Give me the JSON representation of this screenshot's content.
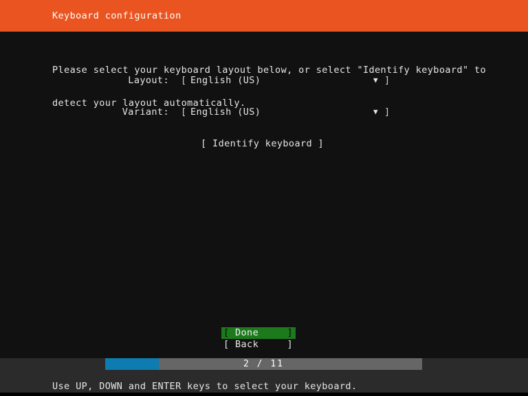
{
  "header": {
    "title": "Keyboard configuration",
    "background_color": "#e95420",
    "text_color": "#ffffff"
  },
  "body": {
    "background_color": "#111111",
    "text_color": "#e6e6e6",
    "prompt_line_1": "Please select your keyboard layout below, or select \"Identify keyboard\" to",
    "prompt_line_2": "detect your layout automatically."
  },
  "form": {
    "bracket_open": "[",
    "bracket_close": "]",
    "dropdown_icon": "▼",
    "rows": [
      {
        "label": "Layout:",
        "value": "English (US)",
        "icon_name": "chevron-down-icon"
      },
      {
        "label": "Variant:",
        "value": "English (US)",
        "icon_name": "chevron-down-icon"
      }
    ]
  },
  "actions": {
    "identify_button": "[ Identify keyboard ]",
    "done": {
      "bracket_open": "[",
      "label": "Done",
      "bracket_close": "]",
      "selected": "true",
      "highlight_color": "#1c7a1c"
    },
    "back": {
      "bracket_open": "[",
      "label": "Back",
      "bracket_close": "]",
      "selected": "false"
    }
  },
  "progress": {
    "text": "2 / 11",
    "current_step": 2,
    "total_steps": 11,
    "fill_color": "#0e7cb0",
    "track_color": "#666666",
    "fill_percent": 17
  },
  "footer": {
    "background_color": "#2b2b2b",
    "hint": "Use UP, DOWN and ENTER keys to select your keyboard."
  }
}
